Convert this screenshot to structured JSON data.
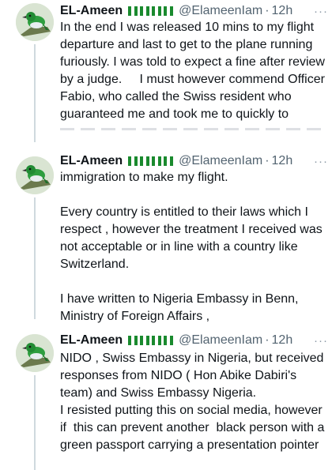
{
  "tweets": [
    {
      "name": "EL-Ameen",
      "handle": "@ElameenIam",
      "separator": "·",
      "time": "12h",
      "more": "···",
      "text": "In the end I was released 10 mins to my flight departure and last to get to the plane running furiously. I was told to expect a fine after review by a judge.     I must however commend Officer Fabio, who called the Swiss resident who guaranteed me and took me to quickly to"
    },
    {
      "name": "EL-Ameen",
      "handle": "@ElameenIam",
      "separator": "·",
      "time": "12h",
      "more": "···",
      "text": "immigration to make my flight.\n\nEvery country is entitled to their laws which I respect , however the treatment I received was not acceptable or in line with a country like Switzerland.\n\nI have written to Nigeria Embassy in Benn, Ministry of Foreign Affairs ,"
    },
    {
      "name": "EL-Ameen",
      "handle": "@ElameenIam",
      "separator": "·",
      "time": "12h",
      "more": "···",
      "text": "NIDO , Swiss Embassy in Nigeria, but received responses from NIDO ( Hon Abike Dabiri's team) and Swiss Embassy Nigeria.\nI resisted putting this on social media, however if  this can prevent another  black person with a green passport carrying a presentation pointer"
    }
  ],
  "colors": {
    "flag_green": "#1a8a2e",
    "flag_white": "#ffffff",
    "muted": "#536471",
    "thread_line": "#cfd9de"
  },
  "icons": {
    "avatar": "green-bird-avatar",
    "flag": "nigeria-flag-icon",
    "more": "more-options-icon"
  }
}
